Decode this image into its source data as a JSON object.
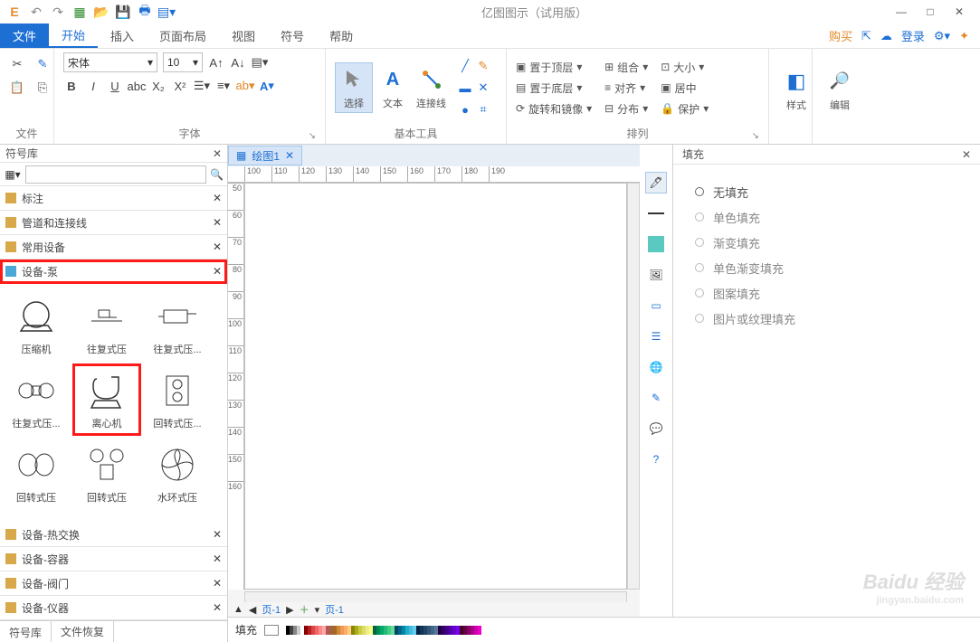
{
  "app": {
    "title": "亿图图示（试用版）"
  },
  "menus": {
    "file": "文件",
    "tabs": [
      "开始",
      "插入",
      "页面布局",
      "视图",
      "符号",
      "帮助"
    ],
    "active": 0,
    "right_buy": "购买",
    "right_login": "登录"
  },
  "ribbon": {
    "file_label": "文件",
    "font_label": "字体",
    "font_name": "宋体",
    "font_size": "10",
    "basic_tools_label": "基本工具",
    "select": "选择",
    "text": "文本",
    "connector": "连接线",
    "arrange_label": "排列",
    "top": "置于顶层",
    "bottom": "置于底层",
    "rotate": "旋转和镜像",
    "group": "组合",
    "align": "对齐",
    "distribute": "分布",
    "size": "大小",
    "center": "居中",
    "protect": "保护",
    "style": "样式",
    "edit": "编辑"
  },
  "left": {
    "title": "符号库",
    "categories": [
      "标注",
      "管道和连接线",
      "常用设备",
      "设备-泵",
      "设备-热交换",
      "设备-容器",
      "设备-阀门",
      "设备-仪器"
    ],
    "shapes_row1": [
      "压缩机",
      "往复式压",
      "往复式压..."
    ],
    "shapes_row2": [
      "往复式压...",
      "离心机",
      "回转式压..."
    ],
    "shapes_row3": [
      "回转式压",
      "回转式压",
      "水环式压"
    ],
    "bottom_tabs": [
      "符号库",
      "文件恢复"
    ]
  },
  "doc": {
    "tab": "绘图1",
    "page_left": "页-1",
    "page_right": "页-1",
    "ruler_h": [
      "100",
      "110",
      "120",
      "130",
      "140",
      "150",
      "160",
      "170",
      "180",
      "190"
    ],
    "ruler_v": [
      "50",
      "60",
      "70",
      "80",
      "90",
      "100",
      "110",
      "120",
      "130",
      "140",
      "150",
      "160"
    ]
  },
  "right": {
    "title": "填充",
    "items": [
      "无填充",
      "单色填充",
      "渐变填充",
      "单色渐变填充",
      "图案填充",
      "图片或纹理填充"
    ]
  },
  "status": {
    "fill_label": "填充"
  },
  "watermark": {
    "main": "Baidu 经验",
    "sub": "jingyan.baidu.com"
  }
}
